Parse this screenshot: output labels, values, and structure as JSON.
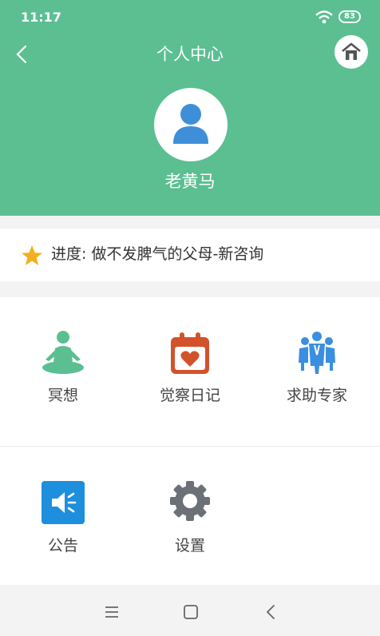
{
  "status_bar": {
    "time": "11:17",
    "battery": "83"
  },
  "header": {
    "title": "个人中心",
    "username": "老黄马"
  },
  "progress": {
    "text": "进度: 做不发脾气的父母-新咨询"
  },
  "features": [
    {
      "label": "冥想",
      "icon": "meditation-icon",
      "color": "#5bbf91"
    },
    {
      "label": "觉察日记",
      "icon": "calendar-heart-icon",
      "color": "#d2522c"
    },
    {
      "label": "求助专家",
      "icon": "experts-icon",
      "color": "#3a8fe0"
    },
    {
      "label": "公告",
      "icon": "speaker-icon",
      "color": "#1d8fdc"
    },
    {
      "label": "设置",
      "icon": "gear-icon",
      "color": "#6b7176"
    }
  ],
  "colors": {
    "header_bg": "#5bbf91",
    "star": "#f2b01e",
    "avatar": "#3e8fd8"
  },
  "nav": {
    "menu_icon": "menu-icon",
    "home_icon": "home-square-icon",
    "back_icon": "back-icon"
  }
}
